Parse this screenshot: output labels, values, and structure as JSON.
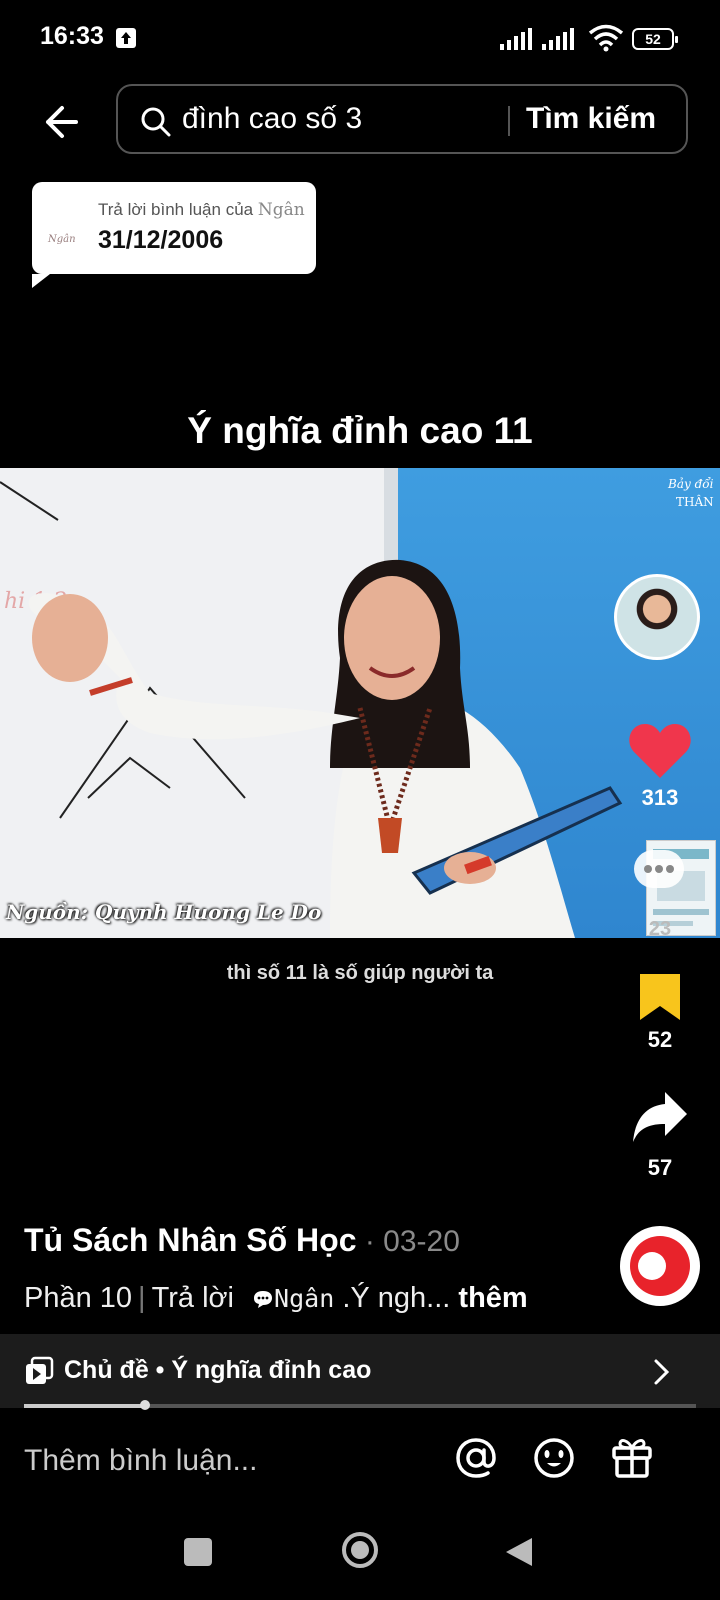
{
  "status_bar": {
    "time": "16:33",
    "battery": "52"
  },
  "search": {
    "query": "đình cao số 3",
    "button_label": "Tìm kiếm"
  },
  "reply_bubble": {
    "mini_name": "Ngân",
    "header_prefix": "Trả lời bình luận của ",
    "header_name": "Ngân",
    "text": "31/12/2006"
  },
  "video": {
    "title": "Ý nghĩa đỉnh cao 11",
    "source_watermark": "Nguồn: Quynh Huong Le Do",
    "subtitle": "thì số 11 là số giúp người ta"
  },
  "rail": {
    "likes": "313",
    "comments": "23",
    "saves": "52",
    "shares": "57"
  },
  "post": {
    "author": "Tủ Sách Nhân Số Học",
    "date": " · 03-20",
    "part": "Phần 10",
    "reply_label": "Trả lời",
    "reply_name": "Ngân",
    "snippet": " .Ý ngh...",
    "more_label": "thêm"
  },
  "topic_bar": {
    "label": "Chủ đề • Ý nghĩa đỉnh cao"
  },
  "playback": {
    "progress": 0.18
  },
  "comment_input": {
    "placeholder": "Thêm bình luận..."
  },
  "colors": {
    "like": "#f0364c",
    "save": "#f8c51c",
    "background": "#000000"
  }
}
